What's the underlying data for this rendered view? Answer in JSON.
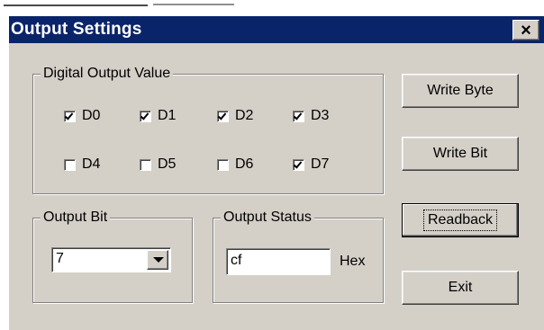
{
  "window": {
    "title": "Output Settings",
    "close_label": "×"
  },
  "digital_output": {
    "legend": "Digital Output Value",
    "bits": [
      {
        "label": "D0",
        "checked": true
      },
      {
        "label": "D1",
        "checked": true
      },
      {
        "label": "D2",
        "checked": true
      },
      {
        "label": "D3",
        "checked": true
      },
      {
        "label": "D4",
        "checked": false
      },
      {
        "label": "D5",
        "checked": false
      },
      {
        "label": "D6",
        "checked": false
      },
      {
        "label": "D7",
        "checked": true
      }
    ]
  },
  "output_bit": {
    "legend": "Output Bit",
    "selected": "7"
  },
  "output_status": {
    "legend": "Output Status",
    "value": "cf",
    "unit": "Hex"
  },
  "buttons": {
    "write_byte": "Write Byte",
    "write_bit": "Write Bit",
    "readback": "Readback",
    "exit": "Exit"
  },
  "icons": {
    "close": "close-icon",
    "dropdown": "chevron-down-icon"
  }
}
